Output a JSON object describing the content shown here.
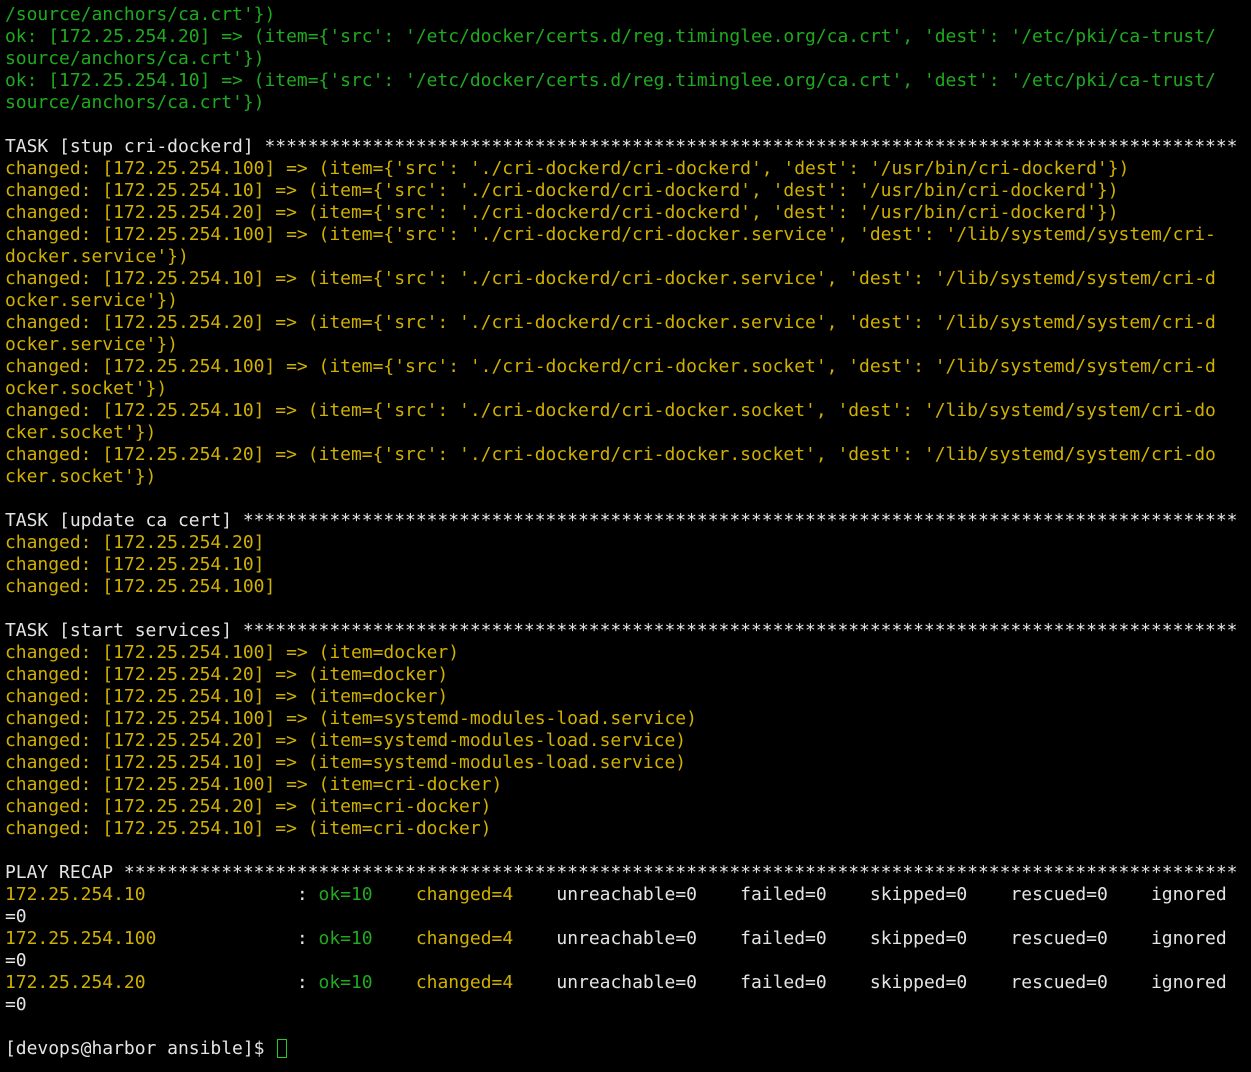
{
  "colors": {
    "background": "#000000",
    "ok": "#1faa1f",
    "changed": "#d0b000",
    "default": "#e4e4e4",
    "cursor": "#22cc22"
  },
  "lines": [
    {
      "c": "ok",
      "t": "/source/anchors/ca.crt'})"
    },
    {
      "c": "ok",
      "t": "ok: [172.25.254.20] => (item={'src': '/etc/docker/certs.d/reg.timinglee.org/ca.crt', 'dest': '/etc/pki/ca-trust/"
    },
    {
      "c": "ok",
      "t": "source/anchors/ca.crt'})"
    },
    {
      "c": "ok",
      "t": "ok: [172.25.254.10] => (item={'src': '/etc/docker/certs.d/reg.timinglee.org/ca.crt', 'dest': '/etc/pki/ca-trust/"
    },
    {
      "c": "ok",
      "t": "source/anchors/ca.crt'})"
    },
    {
      "c": "plain",
      "t": ""
    },
    {
      "c": "plain",
      "t": "TASK [stup cri-dockerd] ******************************************************************************************"
    },
    {
      "c": "changed",
      "t": "changed: [172.25.254.100] => (item={'src': './cri-dockerd/cri-dockerd', 'dest': '/usr/bin/cri-dockerd'})"
    },
    {
      "c": "changed",
      "t": "changed: [172.25.254.10] => (item={'src': './cri-dockerd/cri-dockerd', 'dest': '/usr/bin/cri-dockerd'})"
    },
    {
      "c": "changed",
      "t": "changed: [172.25.254.20] => (item={'src': './cri-dockerd/cri-dockerd', 'dest': '/usr/bin/cri-dockerd'})"
    },
    {
      "c": "changed",
      "t": "changed: [172.25.254.100] => (item={'src': './cri-dockerd/cri-docker.service', 'dest': '/lib/systemd/system/cri-"
    },
    {
      "c": "changed",
      "t": "docker.service'})"
    },
    {
      "c": "changed",
      "t": "changed: [172.25.254.10] => (item={'src': './cri-dockerd/cri-docker.service', 'dest': '/lib/systemd/system/cri-d"
    },
    {
      "c": "changed",
      "t": "ocker.service'})"
    },
    {
      "c": "changed",
      "t": "changed: [172.25.254.20] => (item={'src': './cri-dockerd/cri-docker.service', 'dest': '/lib/systemd/system/cri-d"
    },
    {
      "c": "changed",
      "t": "ocker.service'})"
    },
    {
      "c": "changed",
      "t": "changed: [172.25.254.100] => (item={'src': './cri-dockerd/cri-docker.socket', 'dest': '/lib/systemd/system/cri-d"
    },
    {
      "c": "changed",
      "t": "ocker.socket'})"
    },
    {
      "c": "changed",
      "t": "changed: [172.25.254.10] => (item={'src': './cri-dockerd/cri-docker.socket', 'dest': '/lib/systemd/system/cri-do"
    },
    {
      "c": "changed",
      "t": "cker.socket'})"
    },
    {
      "c": "changed",
      "t": "changed: [172.25.254.20] => (item={'src': './cri-dockerd/cri-docker.socket', 'dest': '/lib/systemd/system/cri-do"
    },
    {
      "c": "changed",
      "t": "cker.socket'})"
    },
    {
      "c": "plain",
      "t": ""
    },
    {
      "c": "plain",
      "t": "TASK [update ca cert] ********************************************************************************************"
    },
    {
      "c": "changed",
      "t": "changed: [172.25.254.20]"
    },
    {
      "c": "changed",
      "t": "changed: [172.25.254.10]"
    },
    {
      "c": "changed",
      "t": "changed: [172.25.254.100]"
    },
    {
      "c": "plain",
      "t": ""
    },
    {
      "c": "plain",
      "t": "TASK [start services] ********************************************************************************************"
    },
    {
      "c": "changed",
      "t": "changed: [172.25.254.100] => (item=docker)"
    },
    {
      "c": "changed",
      "t": "changed: [172.25.254.20] => (item=docker)"
    },
    {
      "c": "changed",
      "t": "changed: [172.25.254.10] => (item=docker)"
    },
    {
      "c": "changed",
      "t": "changed: [172.25.254.100] => (item=systemd-modules-load.service)"
    },
    {
      "c": "changed",
      "t": "changed: [172.25.254.20] => (item=systemd-modules-load.service)"
    },
    {
      "c": "changed",
      "t": "changed: [172.25.254.10] => (item=systemd-modules-load.service)"
    },
    {
      "c": "changed",
      "t": "changed: [172.25.254.100] => (item=cri-docker)"
    },
    {
      "c": "changed",
      "t": "changed: [172.25.254.20] => (item=cri-docker)"
    },
    {
      "c": "changed",
      "t": "changed: [172.25.254.10] => (item=cri-docker)"
    },
    {
      "c": "plain",
      "t": ""
    },
    {
      "c": "plain",
      "t": "PLAY RECAP *******************************************************************************************************"
    }
  ],
  "recap": [
    {
      "host": "172.25.254.10",
      "ok": "ok=10",
      "changed": "changed=4",
      "rest": "    unreachable=0    failed=0    skipped=0    rescued=0    ignored",
      "wrap": "=0"
    },
    {
      "host": "172.25.254.100",
      "ok": "ok=10",
      "changed": "changed=4",
      "rest": "    unreachable=0    failed=0    skipped=0    rescued=0    ignored",
      "wrap": "=0"
    },
    {
      "host": "172.25.254.20",
      "ok": "ok=10",
      "changed": "changed=4",
      "rest": "    unreachable=0    failed=0    skipped=0    rescued=0    ignored",
      "wrap": "=0"
    }
  ],
  "prompt": "[devops@harbor ansible]$ "
}
